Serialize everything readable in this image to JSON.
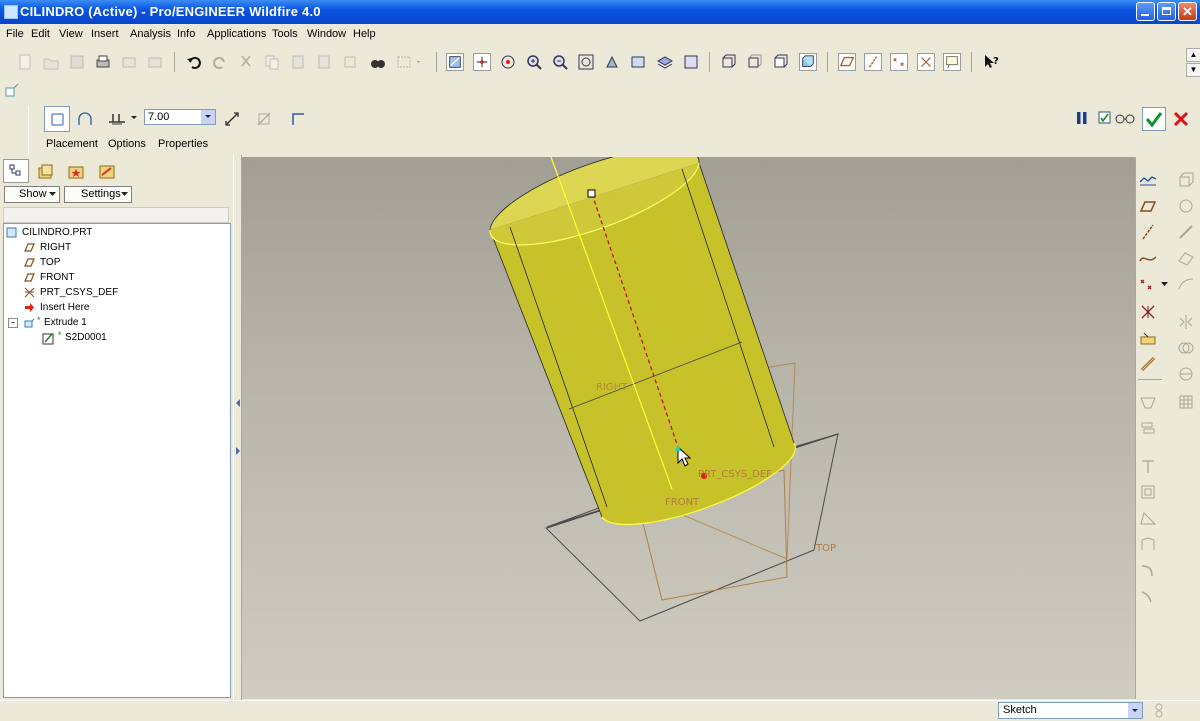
{
  "window": {
    "title": "CILINDRO (Active) - Pro/ENGINEER Wildfire 4.0"
  },
  "menu": [
    "File",
    "Edit",
    "View",
    "Insert",
    "Analysis",
    "Info",
    "Applications",
    "Tools",
    "Window",
    "Help"
  ],
  "dashboard": {
    "depth_value": "7.00",
    "tabs": [
      "Placement",
      "Options",
      "Properties"
    ]
  },
  "navigator": {
    "show_label": "Show",
    "settings_label": "Settings",
    "tree": [
      {
        "label": "CILINDRO.PRT",
        "icon": "part-icon"
      },
      {
        "label": "RIGHT",
        "icon": "datum-plane-icon"
      },
      {
        "label": "TOP",
        "icon": "datum-plane-icon"
      },
      {
        "label": "FRONT",
        "icon": "datum-plane-icon"
      },
      {
        "label": "PRT_CSYS_DEF",
        "icon": "csys-icon"
      },
      {
        "label": "Insert Here",
        "icon": "insert-arrow-icon"
      },
      {
        "label": "Extrude 1",
        "icon": "extrude-icon"
      },
      {
        "label": "S2D0001",
        "icon": "sketch-icon"
      }
    ]
  },
  "viewport": {
    "datum_labels": [
      "RIGHT",
      "PRT_CSYS_DEF",
      "FRONT",
      "TOP"
    ]
  },
  "status": {
    "filter": "Sketch"
  },
  "colors": {
    "model": "#c8c22a",
    "titlebar": "#0a54e3",
    "datum": "#b07a3a"
  }
}
